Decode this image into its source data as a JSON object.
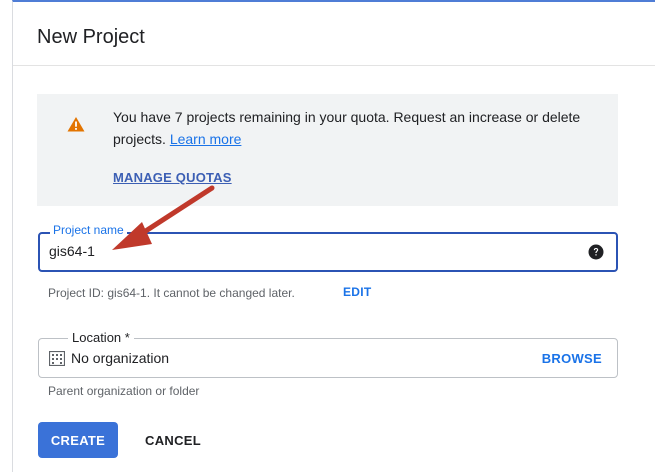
{
  "dialog": {
    "title": "New Project"
  },
  "quota_banner": {
    "icon": "warning-icon",
    "message": "You have 7 projects remaining in your quota. Request an increase or delete projects.",
    "learn_more": "Learn more",
    "manage_quotas": "MANAGE QUOTAS"
  },
  "project_name": {
    "label": "Project name",
    "value": "gis64-1",
    "help_icon": "help-icon"
  },
  "project_id": {
    "text": "Project ID: gis64-1. It cannot be changed later.",
    "edit_label": "EDIT"
  },
  "location": {
    "label": "Location *",
    "icon": "building-icon",
    "value": "No organization",
    "browse_label": "BROWSE",
    "hint": "Parent organization or folder"
  },
  "actions": {
    "create": "CREATE",
    "cancel": "CANCEL"
  },
  "colors": {
    "primary": "#1a73e8",
    "create_button": "#3a72d8",
    "focus_border": "#2b53b4",
    "warning": "#e37400",
    "annotation_arrow": "#c0392b"
  }
}
